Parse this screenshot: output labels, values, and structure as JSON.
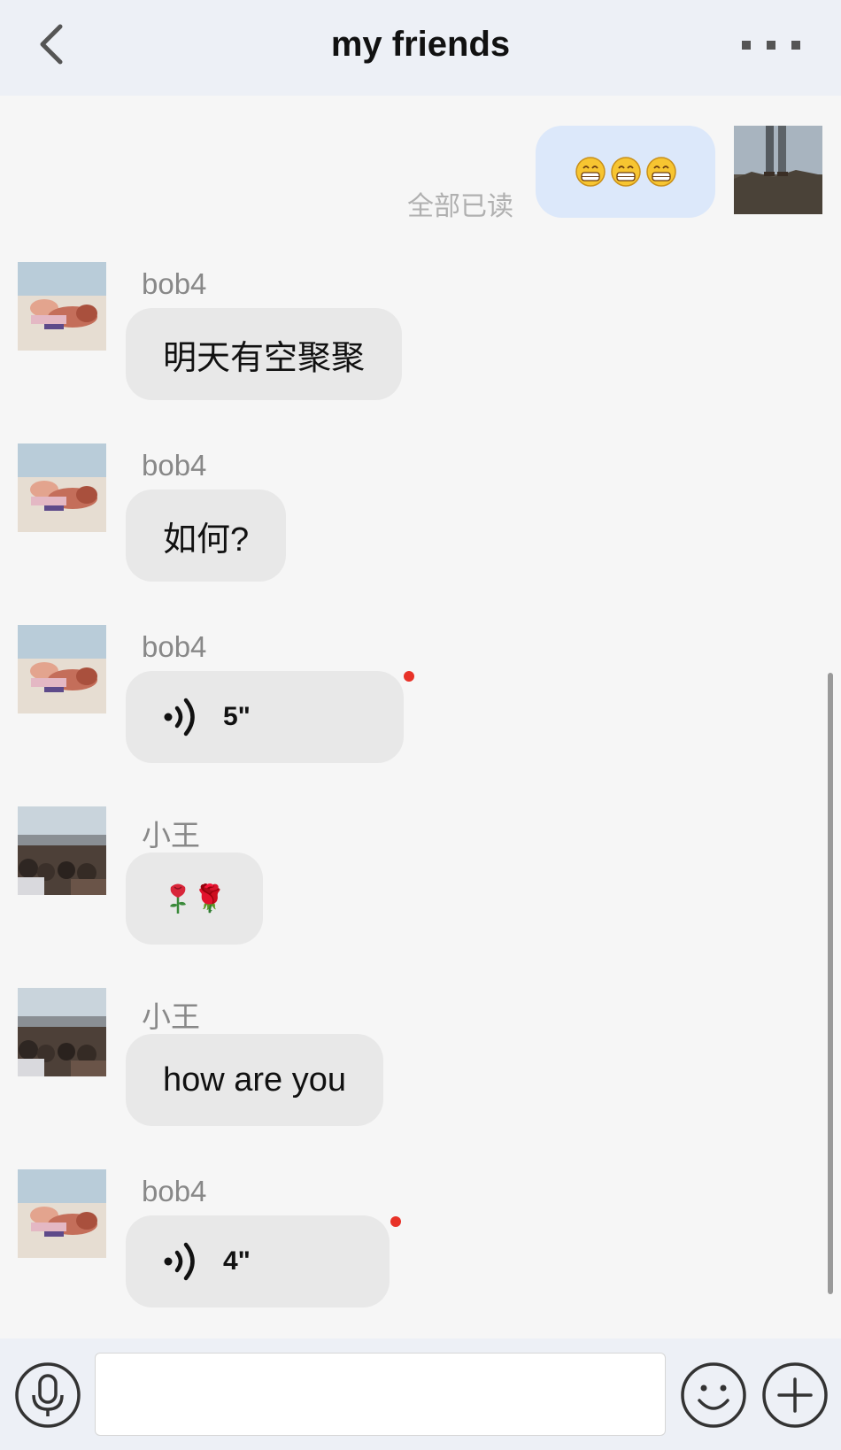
{
  "header": {
    "title": "my friends",
    "back_icon": "chevron-left-icon",
    "more_icon": "more-dots-icon"
  },
  "messages": [
    {
      "direction": "outgoing",
      "content": "😁😁😁",
      "status": "全部已读"
    },
    {
      "direction": "incoming",
      "sender": "bob4",
      "type": "text",
      "content": "明天有空聚聚"
    },
    {
      "direction": "incoming",
      "sender": "bob4",
      "type": "text",
      "content": "如何?"
    },
    {
      "direction": "incoming",
      "sender": "bob4",
      "type": "voice",
      "duration": "5\"",
      "unread": true
    },
    {
      "direction": "incoming",
      "sender": "小王",
      "type": "text",
      "content": "🌹"
    },
    {
      "direction": "incoming",
      "sender": "小王",
      "type": "text",
      "content": "how are you"
    },
    {
      "direction": "incoming",
      "sender": "bob4",
      "type": "voice",
      "duration": "4\"",
      "unread": true
    }
  ],
  "input_bar": {
    "voice_icon": "microphone-icon",
    "text_value": "",
    "emoji_icon": "smiley-icon",
    "add_icon": "plus-circle-icon"
  },
  "colors": {
    "header_bg": "#edf0f6",
    "chat_bg": "#f6f6f6",
    "incoming_bubble": "#e8e8e8",
    "outgoing_bubble": "#dce8fa",
    "unread_dot": "#e83228"
  }
}
